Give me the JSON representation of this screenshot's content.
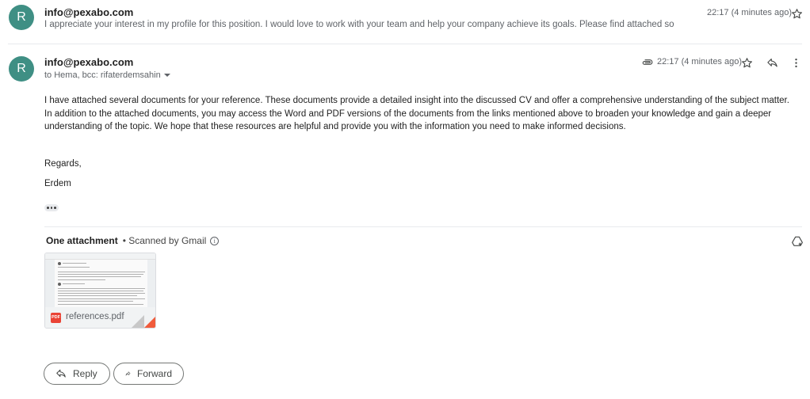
{
  "collapsed_message": {
    "avatar_letter": "R",
    "sender": "info@pexabo.com",
    "snippet": "I appreciate your interest in my profile for this position. I would love to work with your team and help your company achieve its goals. Please find attached so",
    "time": "22:17 (4 minutes ago)"
  },
  "expanded_message": {
    "avatar_letter": "R",
    "sender": "info@pexabo.com",
    "recipients": "to Hema, bcc: rifaterdemsahin",
    "time": "22:17 (4 minutes ago)",
    "body": "I have attached several documents for your reference. These documents provide a detailed insight into the discussed CV and offer a comprehensive understanding of the subject matter. In addition to the attached documents, you may access the Word and PDF versions of the documents from the links mentioned above to broaden your knowledge and gain a deeper understanding of the topic. We hope that these resources are helpful and provide you with the information you need to make informed decisions.",
    "closing": "Regards,",
    "signature": "Erdem"
  },
  "attachments": {
    "heading": "One attachment",
    "scan_note": "• Scanned by Gmail",
    "files": [
      {
        "name": "references.pdf",
        "type_label": "PDF"
      }
    ]
  },
  "actions": {
    "reply_label": "Reply",
    "forward_label": "Forward"
  },
  "colors": {
    "avatar": "#3f8f84",
    "pdf_badge": "#ea4335"
  }
}
